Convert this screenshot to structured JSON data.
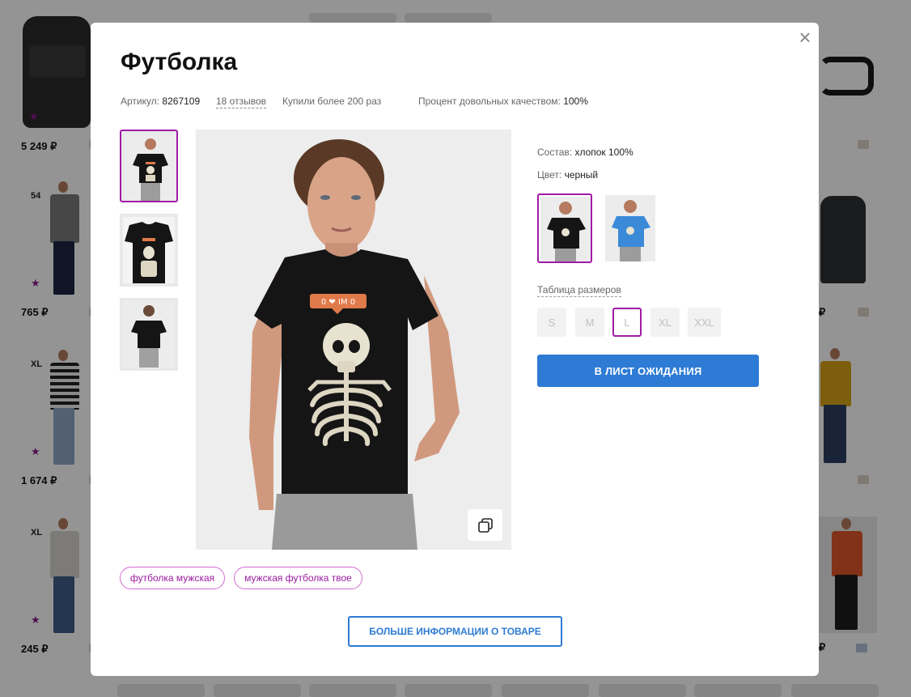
{
  "background": {
    "prices": [
      "5 249 ₽",
      "765 ₽",
      "1 674 ₽",
      "245 ₽",
      "₽",
      "₽",
      "₽"
    ],
    "sizes": [
      "54",
      "XL",
      "XL"
    ]
  },
  "modal": {
    "title": "Футболка",
    "close_icon": "close-icon",
    "article_label": "Артикул:",
    "article_value": "8267109",
    "reviews_link": "18 отзывов",
    "bought_text": "Купили более 200 раз",
    "quality_label": "Процент довольных качеством:",
    "quality_value": "100%",
    "composition_label": "Состав:",
    "composition_value": "хлопок 100%",
    "color_label": "Цвет:",
    "color_value": "черный",
    "size_table_link": "Таблица размеров",
    "sizes": [
      {
        "label": "S",
        "selected": false
      },
      {
        "label": "M",
        "selected": false
      },
      {
        "label": "L",
        "selected": true
      },
      {
        "label": "XL",
        "selected": false
      },
      {
        "label": "XXL",
        "selected": false
      }
    ],
    "waitlist_button": "В ЛИСТ ОЖИДАНИЯ",
    "tags": [
      "футболка мужская",
      "мужская футболка твое"
    ],
    "more_info_button": "БОЛЬШЕ ИНФОРМАЦИИ О ТОВАРЕ",
    "print_text": "0 ❤ IM 0",
    "colors": {
      "accent": "#a11aa6",
      "button_blue": "#2d7bd4",
      "tshirt_black": "#151515",
      "tshirt_blue": "#3a8ad8"
    }
  }
}
